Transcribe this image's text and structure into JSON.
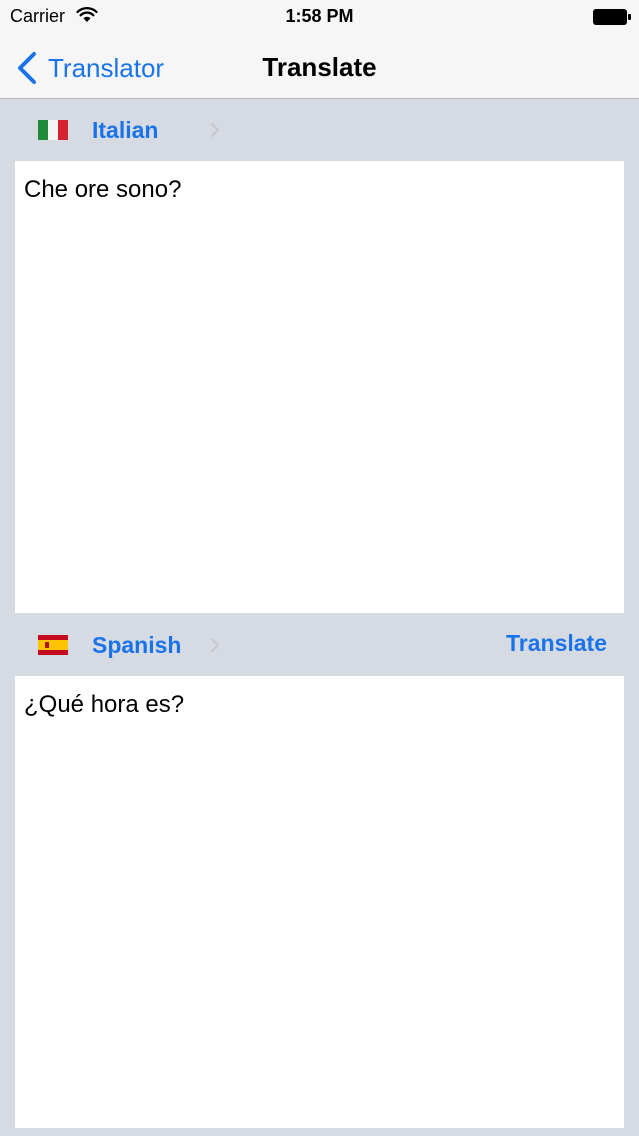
{
  "status_bar": {
    "carrier": "Carrier",
    "time": "1:58 PM"
  },
  "nav": {
    "back_label": "Translator",
    "title": "Translate"
  },
  "source": {
    "language": "Italian",
    "flag": "italy-flag-icon",
    "text": "Che ore sono?"
  },
  "target": {
    "language": "Spanish",
    "flag": "spain-flag-icon",
    "text": "¿Qué hora es?",
    "translate_label": "Translate"
  },
  "colors": {
    "accent": "#1a73e8",
    "background": "#d6dbe3",
    "bar": "#f6f6f7"
  }
}
